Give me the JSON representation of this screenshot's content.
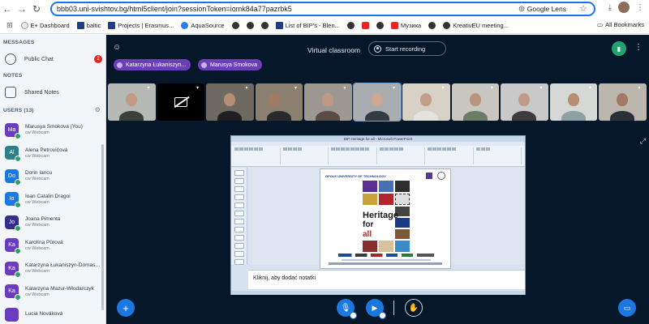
{
  "browser": {
    "url": "bbb03.uni-svishtov.bg/html5client/join?sessionToken=iomk84a77pazrbk5",
    "lens_label": "Google Lens",
    "bookmarks": [
      "E+ Dashboard",
      "baltic",
      "Projects | Erasmus...",
      "AquaSource",
      "List of BIP's - Blen...",
      "Музика",
      "KreativEU meeting..."
    ],
    "all_bookmarks": "All Bookmarks"
  },
  "left": {
    "messages_title": "MESSAGES",
    "public_chat": "Public Chat",
    "public_chat_badge": "2",
    "notes_title": "NOTES",
    "shared_notes": "Shared Notes",
    "users_title": "USERS (13)",
    "users": [
      {
        "initials": "Ma",
        "name": "Marusya Smokova (You)",
        "sub": "cw Webcam",
        "color": "#6a3cc0"
      },
      {
        "initials": "Al",
        "name": "Alena Petrovičová",
        "sub": "cw Webcam",
        "color": "#2a7f8a"
      },
      {
        "initials": "Do",
        "name": "Dorin Iancu",
        "sub": "cw Webcam",
        "color": "#1b78e0"
      },
      {
        "initials": "Io",
        "name": "Ioan Catalin Dragoi",
        "sub": "cw Webcam",
        "color": "#1b78e0"
      },
      {
        "initials": "Jo",
        "name": "Joana Pimenta",
        "sub": "cw Webcam",
        "color": "#33308a"
      },
      {
        "initials": "Ka",
        "name": "Karolína Půrová",
        "sub": "cw Webcam",
        "color": "#6a3cc0"
      },
      {
        "initials": "Ka",
        "name": "Katarzyna Łukaniszyn-Domaszews...",
        "sub": "cw Webcam",
        "color": "#6a3cc0"
      },
      {
        "initials": "Ka",
        "name": "Katarzyna Mazur-Włodarczyk",
        "sub": "cw Webcam",
        "color": "#6a3cc0"
      },
      {
        "initials": "",
        "name": "Lucia Nováková",
        "sub": "",
        "color": "#6a3cc0"
      }
    ]
  },
  "main": {
    "title": "Virtual classroom",
    "record_label": "Start recording",
    "talkers": [
      "Katarzyna Łukaniszyn...",
      "Marusya Smokova"
    ],
    "notes_placeholder": "Kliknij, aby dodać notatki",
    "ppt_window_title": "BIP Heritage for all - Microsoft PowerPoint",
    "slide": {
      "logo": "OPOLE UNIVERSITY OF TECHNOLOGY",
      "heading1": "Heritage",
      "heading2": "for",
      "heading3": "all"
    }
  }
}
